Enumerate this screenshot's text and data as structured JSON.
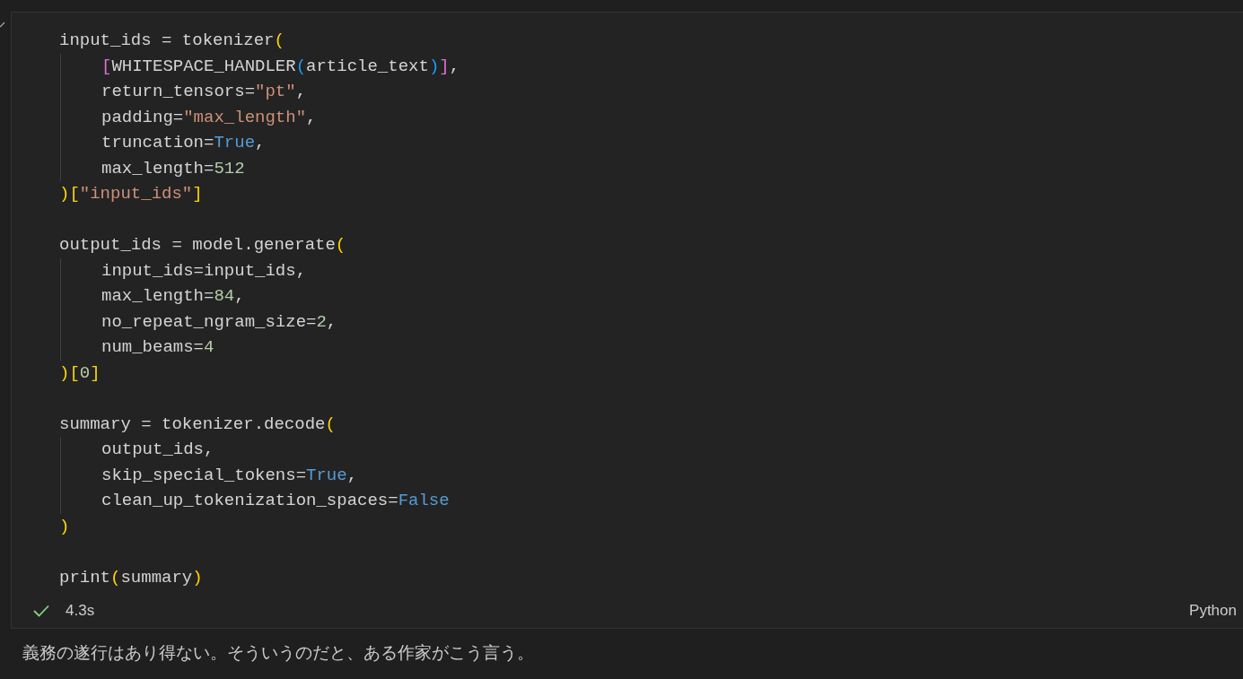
{
  "cell": {
    "blocks": [
      {
        "lines": [
          {
            "tokens": [
              {
                "text": "input_ids = tokenizer",
                "kind": "plain"
              },
              {
                "text": "(",
                "kind": "bracket1"
              }
            ],
            "children": [
              {
                "tokens": [
                  {
                    "text": "[",
                    "kind": "bracket2"
                  },
                  {
                    "text": "WHITESPACE_HANDLER",
                    "kind": "plain"
                  },
                  {
                    "text": "(",
                    "kind": "bracket3"
                  },
                  {
                    "text": "article_text",
                    "kind": "plain"
                  },
                  {
                    "text": ")",
                    "kind": "bracket3"
                  },
                  {
                    "text": "]",
                    "kind": "bracket2"
                  },
                  {
                    "text": ",",
                    "kind": "plain"
                  }
                ]
              },
              {
                "tokens": [
                  {
                    "text": "return_tensors=",
                    "kind": "plain"
                  },
                  {
                    "text": "\"pt\"",
                    "kind": "string"
                  },
                  {
                    "text": ",",
                    "kind": "plain"
                  }
                ]
              },
              {
                "tokens": [
                  {
                    "text": "padding=",
                    "kind": "plain"
                  },
                  {
                    "text": "\"max_length\"",
                    "kind": "string"
                  },
                  {
                    "text": ",",
                    "kind": "plain"
                  }
                ]
              },
              {
                "tokens": [
                  {
                    "text": "truncation=",
                    "kind": "plain"
                  },
                  {
                    "text": "True",
                    "kind": "keyword"
                  },
                  {
                    "text": ",",
                    "kind": "plain"
                  }
                ]
              },
              {
                "tokens": [
                  {
                    "text": "max_length=",
                    "kind": "plain"
                  },
                  {
                    "text": "512",
                    "kind": "number"
                  }
                ]
              }
            ]
          },
          {
            "tokens": [
              {
                "text": ")[",
                "kind": "bracket1"
              },
              {
                "text": "\"input_ids\"",
                "kind": "string"
              },
              {
                "text": "]",
                "kind": "bracket1"
              }
            ]
          }
        ]
      },
      {
        "lines": [
          {
            "tokens": [
              {
                "text": "output_ids = model.generate",
                "kind": "plain"
              },
              {
                "text": "(",
                "kind": "bracket1"
              }
            ],
            "children": [
              {
                "tokens": [
                  {
                    "text": "input_ids=input_ids,",
                    "kind": "plain"
                  }
                ]
              },
              {
                "tokens": [
                  {
                    "text": "max_length=",
                    "kind": "plain"
                  },
                  {
                    "text": "84",
                    "kind": "number"
                  },
                  {
                    "text": ",",
                    "kind": "plain"
                  }
                ]
              },
              {
                "tokens": [
                  {
                    "text": "no_repeat_ngram_size=",
                    "kind": "plain"
                  },
                  {
                    "text": "2",
                    "kind": "number"
                  },
                  {
                    "text": ",",
                    "kind": "plain"
                  }
                ]
              },
              {
                "tokens": [
                  {
                    "text": "num_beams=",
                    "kind": "plain"
                  },
                  {
                    "text": "4",
                    "kind": "number"
                  }
                ]
              }
            ]
          },
          {
            "tokens": [
              {
                "text": ")[",
                "kind": "bracket1"
              },
              {
                "text": "0",
                "kind": "number"
              },
              {
                "text": "]",
                "kind": "bracket1"
              }
            ]
          }
        ]
      },
      {
        "lines": [
          {
            "tokens": [
              {
                "text": "summary = tokenizer.decode",
                "kind": "plain"
              },
              {
                "text": "(",
                "kind": "bracket1"
              }
            ],
            "children": [
              {
                "tokens": [
                  {
                    "text": "output_ids,",
                    "kind": "plain"
                  }
                ]
              },
              {
                "tokens": [
                  {
                    "text": "skip_special_tokens=",
                    "kind": "plain"
                  },
                  {
                    "text": "True",
                    "kind": "keyword"
                  },
                  {
                    "text": ",",
                    "kind": "plain"
                  }
                ]
              },
              {
                "tokens": [
                  {
                    "text": "clean_up_tokenization_spaces=",
                    "kind": "plain"
                  },
                  {
                    "text": "False",
                    "kind": "keyword"
                  }
                ]
              }
            ]
          },
          {
            "tokens": [
              {
                "text": ")",
                "kind": "bracket1"
              }
            ]
          }
        ]
      },
      {
        "lines": [
          {
            "tokens": [
              {
                "text": "print",
                "kind": "plain"
              },
              {
                "text": "(",
                "kind": "bracket1"
              },
              {
                "text": "summary",
                "kind": "plain"
              },
              {
                "text": ")",
                "kind": "bracket1"
              }
            ]
          }
        ]
      }
    ],
    "status": {
      "succeeded": true,
      "duration": "4.3s",
      "language": "Python"
    }
  },
  "output": "義務の遂行はあり得ない。そういうのだと、ある作家がこう言う。"
}
